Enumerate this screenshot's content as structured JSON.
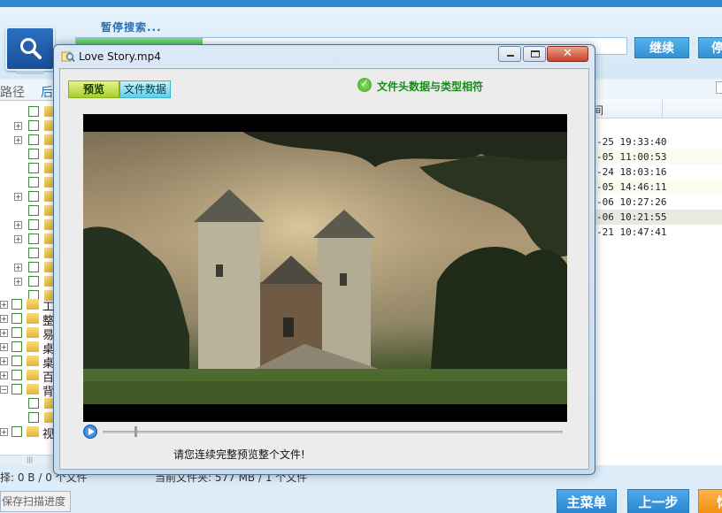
{
  "header": {
    "scan_status": "暂停搜索...",
    "progress_fraction": 0.23,
    "continue_label": "继续",
    "stop_label": "停"
  },
  "left_panel": {
    "tab_path": "路径",
    "tab_second": "后",
    "tree_labels": [
      "工",
      "整",
      "易",
      "桌",
      "桌",
      "百",
      "背",
      "视"
    ]
  },
  "right_panel": {
    "column_header": "间",
    "rows": [
      "-25 19:33:40",
      "-05 11:00:53",
      "-24 18:03:16",
      "-05 14:46:11",
      "-06 10:27:26",
      "-06 10:21:55",
      "-21 10:47:41"
    ]
  },
  "status": {
    "selection": "择: 0 B / 0 个文件",
    "current_folder": "当前文件夹: 577 MB / 1 个文件"
  },
  "footer": {
    "save_progress_label": "保存扫描进度",
    "main_menu_label": "主菜单",
    "prev_step_label": "上一步",
    "extra_label": "恢"
  },
  "modal": {
    "title": "Love Story.mp4",
    "tab_preview": "预览",
    "tab_file_data": "文件数据",
    "verify_text": "文件头数据与类型相符",
    "preview_note": "请您连续完整预览整个文件!",
    "seek_fraction": 0.07
  },
  "colors": {
    "accent": "#2f8bd1",
    "verify_green": "#1a8a1a",
    "progress_green": "#35b335",
    "footer_orange": "#f28f12"
  }
}
